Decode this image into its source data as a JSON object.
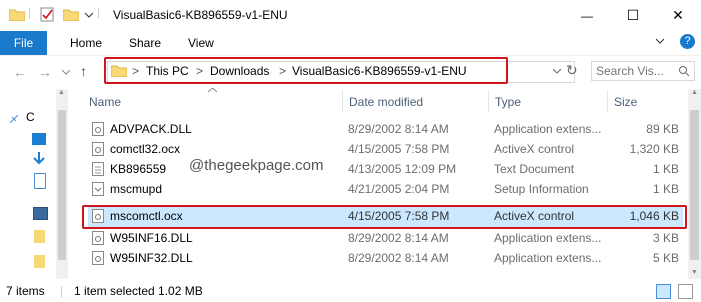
{
  "window": {
    "title": "VisualBasic6-KB896559-v1-ENU",
    "minimize_label": "—",
    "maximize_label": "☐",
    "close_label": "✕",
    "help_label": "?"
  },
  "ribbon": {
    "tabs": [
      {
        "label": "File"
      },
      {
        "label": "Home"
      },
      {
        "label": "Share"
      },
      {
        "label": "View"
      }
    ]
  },
  "address": {
    "crumbs": [
      "This PC",
      "Downloads",
      "VisualBasic6-KB896559-v1-ENU"
    ],
    "separator": ">",
    "search_placeholder": "Search Vis..."
  },
  "columns": {
    "name": "Name",
    "date": "Date modified",
    "type": "Type",
    "size": "Size"
  },
  "files": [
    {
      "name": "ADVPACK.DLL",
      "date": "8/29/2002 8:14 AM",
      "type": "Application extens...",
      "size": "89 KB"
    },
    {
      "name": "comctl32.ocx",
      "date": "4/15/2005 7:58 PM",
      "type": "ActiveX control",
      "size": "1,320 KB"
    },
    {
      "name": "KB896559",
      "date": "4/13/2005 12:09 PM",
      "type": "Text Document",
      "size": "1 KB"
    },
    {
      "name": "mscmupd",
      "date": "4/21/2005 2:04 PM",
      "type": "Setup Information",
      "size": "1 KB"
    },
    {
      "name": "mscomctl.ocx",
      "date": "4/15/2005 7:58 PM",
      "type": "ActiveX control",
      "size": "1,046 KB"
    },
    {
      "name": "W95INF16.DLL",
      "date": "8/29/2002 8:14 AM",
      "type": "Application extens...",
      "size": "3 KB"
    },
    {
      "name": "W95INF32.DLL",
      "date": "8/29/2002 8:14 AM",
      "type": "Application extens...",
      "size": "5 KB"
    }
  ],
  "nav_label": "C",
  "watermark": "@thegeekpage.com",
  "status": {
    "items": "7 items",
    "selected": "1 item selected  1.02 MB"
  },
  "colors": {
    "accent": "#1979ca",
    "highlight_border": "#d2141c",
    "selected_row": "#cce8ff"
  }
}
